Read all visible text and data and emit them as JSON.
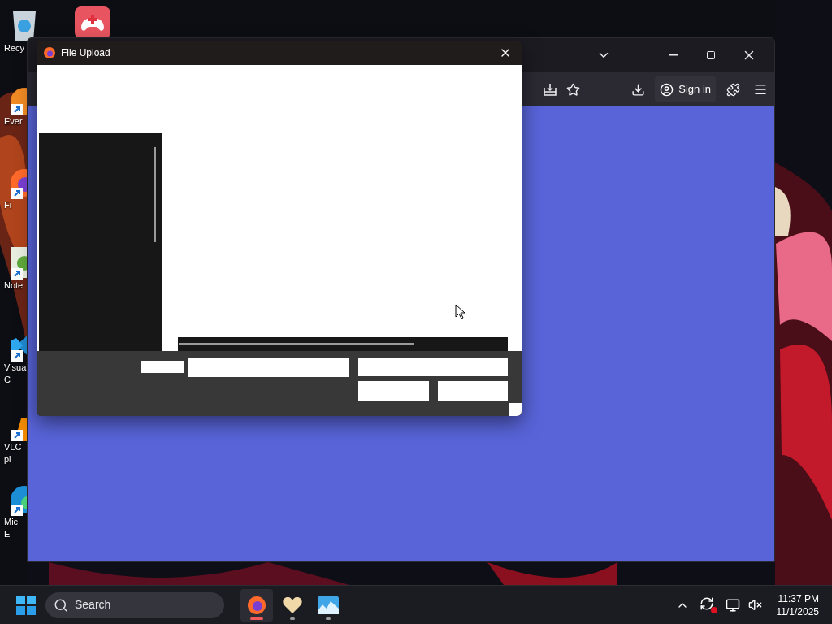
{
  "desktop": {
    "icons": [
      {
        "kind": "recycle-bin",
        "shortcut": false,
        "lines": [
          "Recy"
        ]
      },
      {
        "kind": "gamepad",
        "shortcut": false
      },
      {
        "kind": "orange-app",
        "shortcut": true,
        "lines": [
          "Ever"
        ]
      },
      {
        "kind": "firefox",
        "shortcut": true,
        "lines": [
          "Fi"
        ]
      },
      {
        "kind": "notepad",
        "shortcut": true,
        "lines": [
          "Note"
        ]
      },
      {
        "kind": "code",
        "shortcut": true,
        "lines": [
          "Visua",
          "C"
        ]
      },
      {
        "kind": "cone",
        "shortcut": true,
        "lines": [
          "VLC",
          "pl"
        ]
      },
      {
        "kind": "edge",
        "shortcut": true,
        "lines": [
          "Mic",
          "E"
        ]
      }
    ]
  },
  "browser": {
    "sign_in": "Sign in"
  },
  "dialog": {
    "title": "File Upload"
  },
  "taskbar": {
    "search": {
      "placeholder": "Search"
    },
    "apps": [
      {
        "kind": "firefox",
        "selected": true
      },
      {
        "kind": "heart",
        "selected": false
      },
      {
        "kind": "photos",
        "selected": false
      }
    ],
    "clock": {
      "time": "11:37 PM",
      "date": "11/1/2025"
    }
  }
}
